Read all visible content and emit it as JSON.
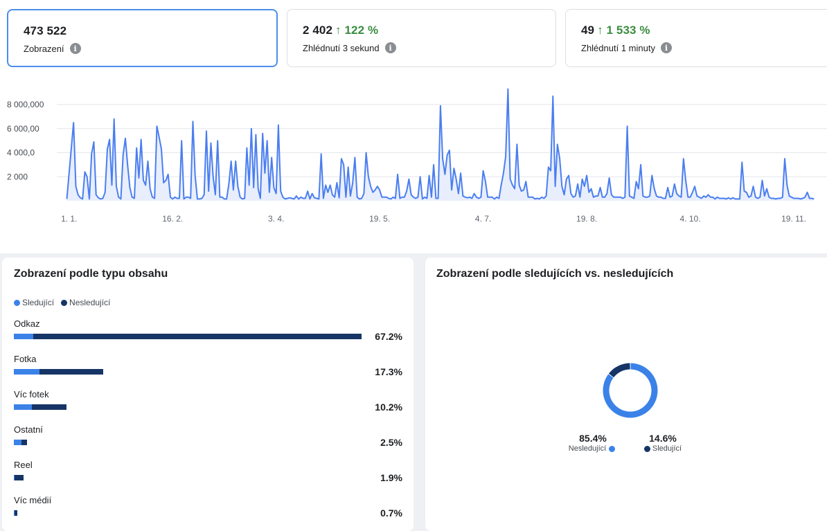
{
  "metrics": [
    {
      "value": "473 522",
      "delta": "",
      "label": "Zobrazení"
    },
    {
      "value": "2 402",
      "delta": "↑ 122 %",
      "label": "Zhlédnutí 3 sekund"
    },
    {
      "value": "49",
      "delta": "↑ 1 533 %",
      "label": "Zhlédnutí 1 minuty"
    }
  ],
  "info_icon": "info-icon",
  "colors": {
    "line": "#4a7ef0",
    "area": "#e8eefc",
    "follower": "#3b82e8",
    "nonfollower": "#163566",
    "grid": "#e4e6eb",
    "delta": "#3a8c3f"
  },
  "chart_data": [
    {
      "type": "line",
      "title": "",
      "xlabel": "",
      "ylabel": "",
      "ytick_labels": [
        "2 000",
        "4 000,0",
        "6 000,00",
        "8 000,000"
      ],
      "y_ticks": [
        2000,
        4000,
        6000,
        8000
      ],
      "ylim": [
        0,
        9500
      ],
      "xtick_labels": [
        "1. 1.",
        "16. 2.",
        "3. 4.",
        "19. 5.",
        "4. 7.",
        "19. 8.",
        "4. 10.",
        "19. 11."
      ],
      "x_days": [
        1,
        47,
        93,
        139,
        185,
        231,
        277,
        323
      ],
      "xlim": [
        -2,
        335
      ],
      "grid": true,
      "x": [
        0,
        3,
        4,
        5,
        6,
        7,
        8,
        9,
        10,
        11,
        12,
        13,
        14,
        15,
        16,
        17,
        18,
        19,
        20,
        21,
        22,
        23,
        24,
        25,
        26,
        27,
        28,
        29,
        30,
        31,
        32,
        33,
        34,
        35,
        36,
        37,
        38,
        39,
        40,
        41,
        42,
        43,
        44,
        45,
        46,
        47,
        48,
        49,
        50,
        51,
        52,
        53,
        54,
        55,
        56,
        57,
        58,
        59,
        60,
        61,
        62,
        63,
        64,
        65,
        66,
        67,
        68,
        69,
        70,
        71,
        72,
        73,
        74,
        75,
        76,
        77,
        78,
        79,
        80,
        81,
        82,
        83,
        84,
        85,
        86,
        87,
        88,
        89,
        90,
        91,
        92,
        93,
        94,
        95,
        96,
        97,
        98,
        99,
        100,
        101,
        102,
        103,
        104,
        105,
        106,
        107,
        108,
        109,
        110,
        111,
        112,
        113,
        114,
        115,
        116,
        117,
        118,
        119,
        120,
        121,
        122,
        123,
        124,
        125,
        126,
        127,
        128,
        129,
        130,
        131,
        132,
        133,
        134,
        135,
        136,
        137,
        138,
        139,
        140,
        141,
        142,
        143,
        144,
        145,
        146,
        147,
        148,
        149,
        150,
        151,
        152,
        153,
        154,
        155,
        156,
        157,
        158,
        159,
        160,
        161,
        162,
        163,
        164,
        165,
        166,
        167,
        168,
        169,
        170,
        171,
        172,
        173,
        174,
        175,
        176,
        177,
        178,
        179,
        180,
        181,
        182,
        183,
        184,
        185,
        186,
        187,
        188,
        189,
        190,
        191,
        192,
        193,
        194,
        195,
        196,
        197,
        198,
        199,
        200,
        201,
        202,
        203,
        204,
        205,
        206,
        207,
        208,
        209,
        210,
        211,
        212,
        213,
        214,
        215,
        216,
        217,
        218,
        219,
        220,
        221,
        222,
        223,
        224,
        225,
        226,
        227,
        228,
        229,
        230,
        231,
        232,
        233,
        234,
        235,
        236,
        237,
        238,
        239,
        240,
        241,
        242,
        243,
        244,
        245,
        246,
        247,
        248,
        249,
        250,
        251,
        252,
        253,
        254,
        255,
        256,
        257,
        258,
        259,
        260,
        261,
        262,
        263,
        264,
        265,
        266,
        267,
        268,
        269,
        270,
        271,
        272,
        273,
        274,
        275,
        276,
        277,
        278,
        279,
        280,
        281,
        282,
        283,
        284,
        285,
        286,
        287,
        288,
        289,
        290,
        291,
        292,
        293,
        294,
        295,
        296,
        297,
        298,
        299,
        300,
        301,
        302,
        303,
        304,
        305,
        306,
        307,
        308,
        309,
        310,
        311,
        312,
        313,
        314,
        315,
        316,
        317,
        318,
        319,
        320,
        321,
        322,
        323,
        324,
        325,
        326,
        327,
        328,
        329,
        330,
        331,
        332
      ],
      "y": [
        150,
        6500,
        1200,
        500,
        250,
        150,
        2400,
        2000,
        150,
        3900,
        4900,
        500,
        250,
        150,
        200,
        700,
        4300,
        5100,
        1300,
        6800,
        1200,
        300,
        150,
        3800,
        5200,
        3000,
        1100,
        300,
        200,
        4400,
        1900,
        5100,
        1700,
        1300,
        3300,
        1000,
        300,
        200,
        6200,
        5300,
        4300,
        1500,
        1700,
        2200,
        300,
        150,
        300,
        200,
        200,
        5000,
        150,
        300,
        300,
        200,
        6600,
        2100,
        150,
        150,
        200,
        500,
        5800,
        800,
        4800,
        2000,
        500,
        5000,
        300,
        300,
        150,
        150,
        1400,
        3300,
        900,
        3300,
        1200,
        300,
        150,
        200,
        4400,
        1300,
        6000,
        1100,
        5500,
        1000,
        200,
        5600,
        2300,
        5000,
        700,
        3600,
        1100,
        600,
        6300,
        800,
        300,
        150,
        200,
        250,
        200,
        150,
        400,
        150,
        300,
        200,
        200,
        800,
        150,
        600,
        250,
        200,
        150,
        3900,
        200,
        1300,
        700,
        1300,
        500,
        300,
        1500,
        250,
        3500,
        3000,
        300,
        2800,
        400,
        1500,
        3600,
        300,
        150,
        200,
        600,
        4000,
        2000,
        1200,
        700,
        900,
        1200,
        900,
        300,
        300,
        300,
        200,
        150,
        300,
        200,
        2200,
        200,
        300,
        300,
        800,
        1800,
        500,
        300,
        200,
        300,
        2000,
        150,
        300,
        200,
        2100,
        300,
        3000,
        200,
        200,
        7900,
        3500,
        2200,
        3800,
        4200,
        900,
        2700,
        1800,
        600,
        2300,
        400,
        300,
        250,
        300,
        200,
        600,
        300,
        200,
        300,
        2500,
        1600,
        300,
        300,
        300,
        150,
        300,
        200,
        1300,
        2300,
        3700,
        9300,
        1800,
        1300,
        1000,
        4700,
        1300,
        800,
        900,
        1600,
        300,
        300,
        300,
        150,
        200,
        150,
        300,
        200,
        400,
        2800,
        2500,
        8700,
        1200,
        4700,
        3500,
        1200,
        500,
        1800,
        2100,
        600,
        300,
        400,
        1400,
        300,
        1800,
        1200,
        2100,
        700,
        1000,
        300,
        400,
        400,
        1100,
        300,
        300,
        600,
        1900,
        500,
        300,
        300,
        300,
        300,
        200,
        300,
        6200,
        400,
        300,
        200,
        1600,
        1000,
        3000,
        400,
        300,
        300,
        400,
        2100,
        1000,
        400,
        300,
        300,
        200,
        200,
        1100,
        300,
        400,
        1400,
        600,
        400,
        300,
        3500,
        1700,
        300,
        300,
        700,
        1200,
        400,
        300,
        200,
        400,
        300,
        500,
        300,
        300,
        150,
        300,
        200,
        200,
        200,
        150,
        250,
        150,
        250,
        150,
        150,
        150,
        3200,
        800,
        700,
        300,
        400,
        1200,
        300,
        200,
        300,
        1700,
        400,
        1000,
        300,
        200,
        200,
        150,
        200,
        200,
        300,
        3500,
        1300,
        400,
        300,
        200,
        200,
        200,
        150,
        200,
        300,
        700,
        200,
        200,
        150,
        300,
        200,
        150,
        150,
        150,
        100,
        100
      ]
    },
    {
      "type": "bar",
      "title": "Zobrazení podle typu obsahu",
      "orientation": "horizontal",
      "stacked": true,
      "categories": [
        "Odkaz",
        "Fotka",
        "Víc fotek",
        "Ostatní",
        "Reel",
        "Víc médií"
      ],
      "totals_label": [
        "67.2%",
        "17.3%",
        "10.2%",
        "2.5%",
        "1.9%",
        "0.7%"
      ],
      "series": [
        {
          "name": "Sledující",
          "values": [
            3.8,
            5.0,
            3.5,
            1.5,
            0.1,
            0.1
          ]
        },
        {
          "name": "Nesledující",
          "values": [
            63.4,
            12.3,
            6.7,
            1.0,
            1.8,
            0.6
          ]
        }
      ],
      "xlim": [
        0,
        67.2
      ]
    },
    {
      "type": "pie",
      "title": "Zobrazení podle sledujících vs. nesledujících",
      "donut": true,
      "categories": [
        "Nesledující",
        "Sledující"
      ],
      "values": [
        85.4,
        14.6
      ],
      "labels": [
        "85.4%",
        "14.6%"
      ]
    }
  ]
}
